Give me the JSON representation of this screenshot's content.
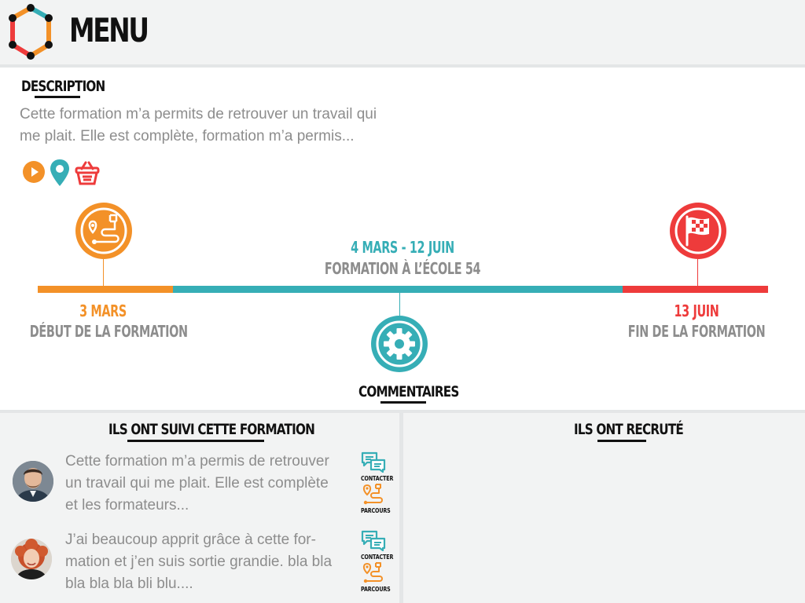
{
  "header": {
    "title": "MENU"
  },
  "description": {
    "heading": "DESCRIPTION",
    "text_line1": "Cette formation m’a permits de retrouver un travail qui",
    "text_line2": "me plait. Elle est complète,  formation m’a permis...",
    "icons": [
      "play-icon",
      "location-pin-icon",
      "basket-icon"
    ]
  },
  "timeline": {
    "start": {
      "date": "3 MARS",
      "label": "DÉBUT DE LA FORMATION",
      "color": "#f39128"
    },
    "middle": {
      "date": "4 MARS - 12 JUIN",
      "label": "FORMATION À L’ÉCOLE 54",
      "color": "#36aeb6"
    },
    "end": {
      "date": "13 JUIN",
      "label": "FIN DE LA FORMATION",
      "color": "#ee3b3b"
    },
    "comments_label": "COMMENTAIRES",
    "label_color": "#8d8d8d"
  },
  "alumni": {
    "heading": "ILS ONT SUIVI CETTE FORMATION",
    "testimonials": [
      {
        "line1": "Cette formation m’a permis de retrouver",
        "line2": "un travail qui me plait. Elle est complète",
        "line3": "et les formateurs...",
        "contact_label": "CONTACTER",
        "path_label": "PARCOURS"
      },
      {
        "line1": "J’ai beaucoup apprit grâce à cette for-",
        "line2": "mation et j’en suis sortie grandie. bla bla",
        "line3": "bla bla bla bli blu....",
        "contact_label": "CONTACTER",
        "path_label": "PARCOURS"
      }
    ]
  },
  "recruiters": {
    "heading": "ILS ONT RECRUTÉ"
  },
  "colors": {
    "orange": "#f39128",
    "teal": "#36aeb6",
    "red": "#ee3b3b",
    "panel": "#f2f3f3",
    "text_gray": "#8d8d8d"
  }
}
